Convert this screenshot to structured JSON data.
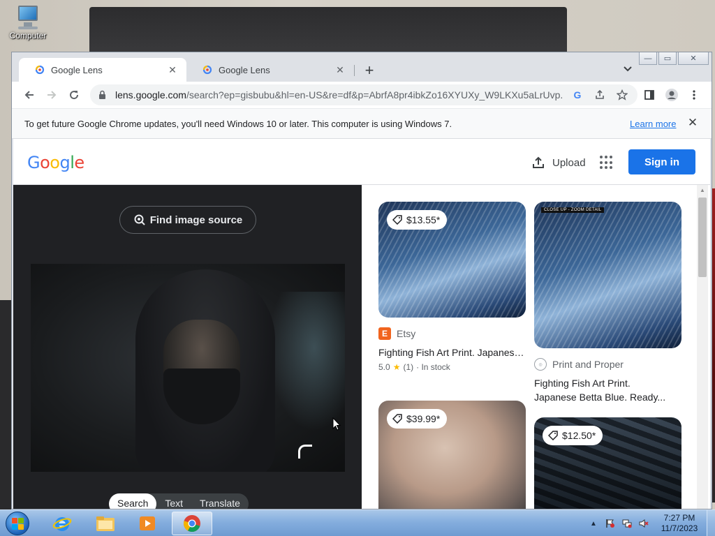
{
  "desktop": {
    "icon_label": "Computer"
  },
  "window": {
    "minimize": "—",
    "maximize": "▭",
    "close": "✕"
  },
  "tabs": [
    {
      "title": "Google Lens",
      "active": true
    },
    {
      "title": "Google Lens",
      "active": false
    }
  ],
  "toolbar": {
    "url_host": "lens.google.com",
    "url_rest": "/search?ep=gisbubu&hl=en-US&re=df&p=AbrfA8pr4ibkZo16XYUXy_W9LKXu5aLrUvp..."
  },
  "infobar": {
    "message": "To get future Google Chrome updates, you'll need Windows 10 or later. This computer is using Windows 7.",
    "link": "Learn more"
  },
  "header": {
    "logo_letters": [
      "G",
      "o",
      "o",
      "g",
      "l",
      "e"
    ],
    "logo_colors": [
      "#4285f4",
      "#ea4335",
      "#fbbc05",
      "#4285f4",
      "#34a853",
      "#ea4335"
    ],
    "upload_label": "Upload",
    "signin_label": "Sign in"
  },
  "lens": {
    "find_source_label": "Find image source",
    "modes": [
      {
        "label": "Search",
        "active": true
      },
      {
        "label": "Text",
        "active": false
      },
      {
        "label": "Translate",
        "active": false
      }
    ]
  },
  "results": [
    {
      "price": "$13.55*",
      "source": "Etsy",
      "source_logo": "E",
      "title": "Fighting Fish Art Print. Japanese Betta Fish. Abstra...",
      "rating": "5.0",
      "reviews": "(1)",
      "stock": "· In stock"
    },
    {
      "badge": "CLOSE UP - ZOOM DETAIL",
      "source": "Print and Proper",
      "title_line1": "Fighting Fish Art Print.",
      "title_line2": "Japanese Betta Blue. Ready..."
    },
    {
      "price": "$39.99*"
    },
    {
      "price": "$12.50*"
    }
  ],
  "taskbar": {
    "time": "7:27 PM",
    "date": "11/7/2023"
  }
}
